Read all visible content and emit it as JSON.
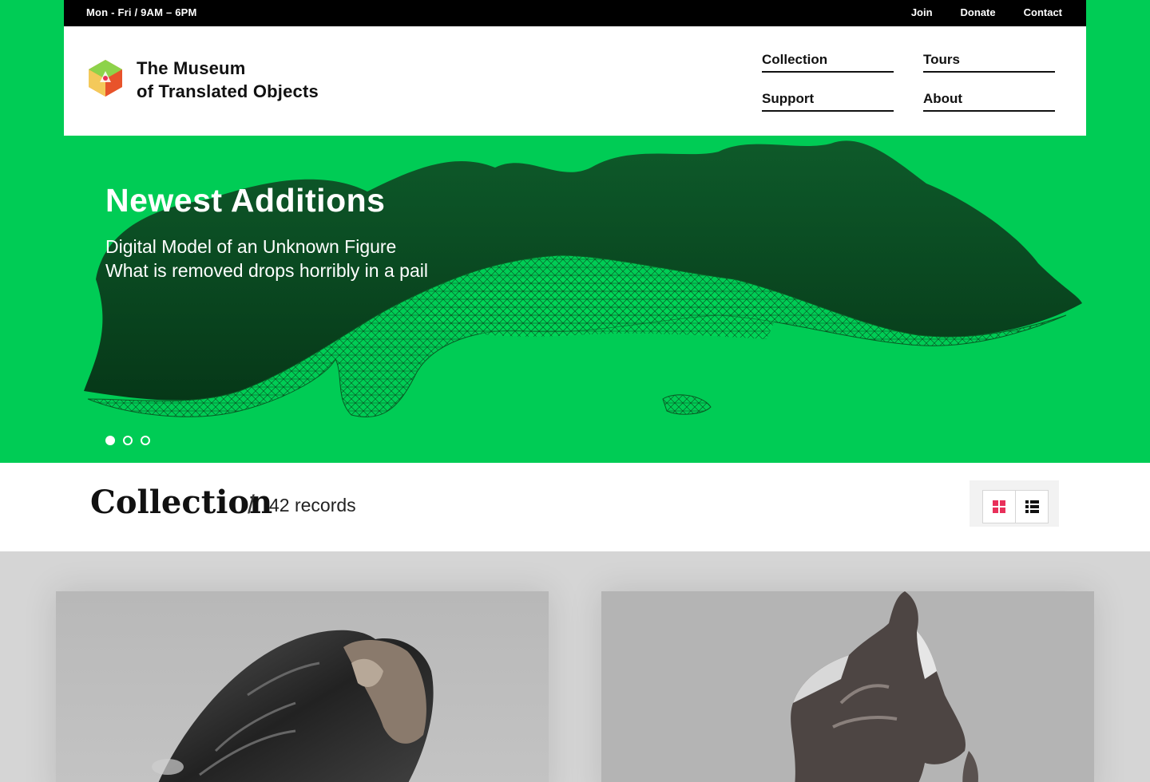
{
  "topbar": {
    "hours": "Mon - Fri  /  9AM – 6PM",
    "links": [
      "Join",
      "Donate",
      "Contact"
    ]
  },
  "header": {
    "logo_line1": "The Museum",
    "logo_line2": "of Translated Objects",
    "nav": [
      "Collection",
      "Tours",
      "Support",
      "About"
    ]
  },
  "hero": {
    "title": "Newest Additions",
    "subtitle_line1": "Digital Model of an Unknown Figure",
    "subtitle_line2": "What is removed drops horribly in a pail",
    "slides": 3,
    "active_slide": 1
  },
  "collection": {
    "title": "Collection",
    "separator": "/",
    "count": "42 records",
    "view_modes": [
      "grid-icon",
      "list-icon"
    ],
    "active_view": "grid"
  },
  "colors": {
    "brand_green": "#00cc55",
    "dark_green": "#0a3d1f",
    "accent_pink": "#e8305a",
    "black": "#000000"
  }
}
